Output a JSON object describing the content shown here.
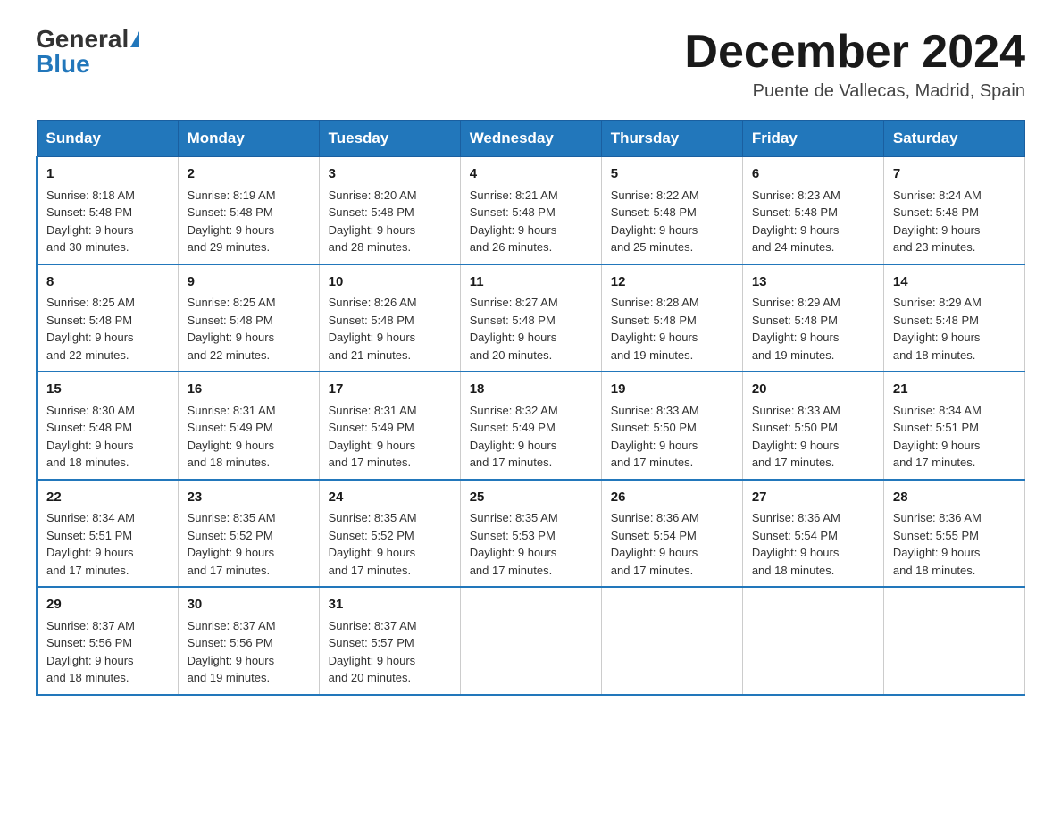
{
  "header": {
    "logo_general": "General",
    "logo_blue": "Blue",
    "month_title": "December 2024",
    "location": "Puente de Vallecas, Madrid, Spain"
  },
  "weekdays": [
    "Sunday",
    "Monday",
    "Tuesday",
    "Wednesday",
    "Thursday",
    "Friday",
    "Saturday"
  ],
  "weeks": [
    [
      {
        "day": "1",
        "sunrise": "8:18 AM",
        "sunset": "5:48 PM",
        "daylight": "9 hours and 30 minutes."
      },
      {
        "day": "2",
        "sunrise": "8:19 AM",
        "sunset": "5:48 PM",
        "daylight": "9 hours and 29 minutes."
      },
      {
        "day": "3",
        "sunrise": "8:20 AM",
        "sunset": "5:48 PM",
        "daylight": "9 hours and 28 minutes."
      },
      {
        "day": "4",
        "sunrise": "8:21 AM",
        "sunset": "5:48 PM",
        "daylight": "9 hours and 26 minutes."
      },
      {
        "day": "5",
        "sunrise": "8:22 AM",
        "sunset": "5:48 PM",
        "daylight": "9 hours and 25 minutes."
      },
      {
        "day": "6",
        "sunrise": "8:23 AM",
        "sunset": "5:48 PM",
        "daylight": "9 hours and 24 minutes."
      },
      {
        "day": "7",
        "sunrise": "8:24 AM",
        "sunset": "5:48 PM",
        "daylight": "9 hours and 23 minutes."
      }
    ],
    [
      {
        "day": "8",
        "sunrise": "8:25 AM",
        "sunset": "5:48 PM",
        "daylight": "9 hours and 22 minutes."
      },
      {
        "day": "9",
        "sunrise": "8:25 AM",
        "sunset": "5:48 PM",
        "daylight": "9 hours and 22 minutes."
      },
      {
        "day": "10",
        "sunrise": "8:26 AM",
        "sunset": "5:48 PM",
        "daylight": "9 hours and 21 minutes."
      },
      {
        "day": "11",
        "sunrise": "8:27 AM",
        "sunset": "5:48 PM",
        "daylight": "9 hours and 20 minutes."
      },
      {
        "day": "12",
        "sunrise": "8:28 AM",
        "sunset": "5:48 PM",
        "daylight": "9 hours and 19 minutes."
      },
      {
        "day": "13",
        "sunrise": "8:29 AM",
        "sunset": "5:48 PM",
        "daylight": "9 hours and 19 minutes."
      },
      {
        "day": "14",
        "sunrise": "8:29 AM",
        "sunset": "5:48 PM",
        "daylight": "9 hours and 18 minutes."
      }
    ],
    [
      {
        "day": "15",
        "sunrise": "8:30 AM",
        "sunset": "5:48 PM",
        "daylight": "9 hours and 18 minutes."
      },
      {
        "day": "16",
        "sunrise": "8:31 AM",
        "sunset": "5:49 PM",
        "daylight": "9 hours and 18 minutes."
      },
      {
        "day": "17",
        "sunrise": "8:31 AM",
        "sunset": "5:49 PM",
        "daylight": "9 hours and 17 minutes."
      },
      {
        "day": "18",
        "sunrise": "8:32 AM",
        "sunset": "5:49 PM",
        "daylight": "9 hours and 17 minutes."
      },
      {
        "day": "19",
        "sunrise": "8:33 AM",
        "sunset": "5:50 PM",
        "daylight": "9 hours and 17 minutes."
      },
      {
        "day": "20",
        "sunrise": "8:33 AM",
        "sunset": "5:50 PM",
        "daylight": "9 hours and 17 minutes."
      },
      {
        "day": "21",
        "sunrise": "8:34 AM",
        "sunset": "5:51 PM",
        "daylight": "9 hours and 17 minutes."
      }
    ],
    [
      {
        "day": "22",
        "sunrise": "8:34 AM",
        "sunset": "5:51 PM",
        "daylight": "9 hours and 17 minutes."
      },
      {
        "day": "23",
        "sunrise": "8:35 AM",
        "sunset": "5:52 PM",
        "daylight": "9 hours and 17 minutes."
      },
      {
        "day": "24",
        "sunrise": "8:35 AM",
        "sunset": "5:52 PM",
        "daylight": "9 hours and 17 minutes."
      },
      {
        "day": "25",
        "sunrise": "8:35 AM",
        "sunset": "5:53 PM",
        "daylight": "9 hours and 17 minutes."
      },
      {
        "day": "26",
        "sunrise": "8:36 AM",
        "sunset": "5:54 PM",
        "daylight": "9 hours and 17 minutes."
      },
      {
        "day": "27",
        "sunrise": "8:36 AM",
        "sunset": "5:54 PM",
        "daylight": "9 hours and 18 minutes."
      },
      {
        "day": "28",
        "sunrise": "8:36 AM",
        "sunset": "5:55 PM",
        "daylight": "9 hours and 18 minutes."
      }
    ],
    [
      {
        "day": "29",
        "sunrise": "8:37 AM",
        "sunset": "5:56 PM",
        "daylight": "9 hours and 18 minutes."
      },
      {
        "day": "30",
        "sunrise": "8:37 AM",
        "sunset": "5:56 PM",
        "daylight": "9 hours and 19 minutes."
      },
      {
        "day": "31",
        "sunrise": "8:37 AM",
        "sunset": "5:57 PM",
        "daylight": "9 hours and 20 minutes."
      },
      null,
      null,
      null,
      null
    ]
  ],
  "labels": {
    "sunrise": "Sunrise:",
    "sunset": "Sunset:",
    "daylight": "Daylight:"
  }
}
